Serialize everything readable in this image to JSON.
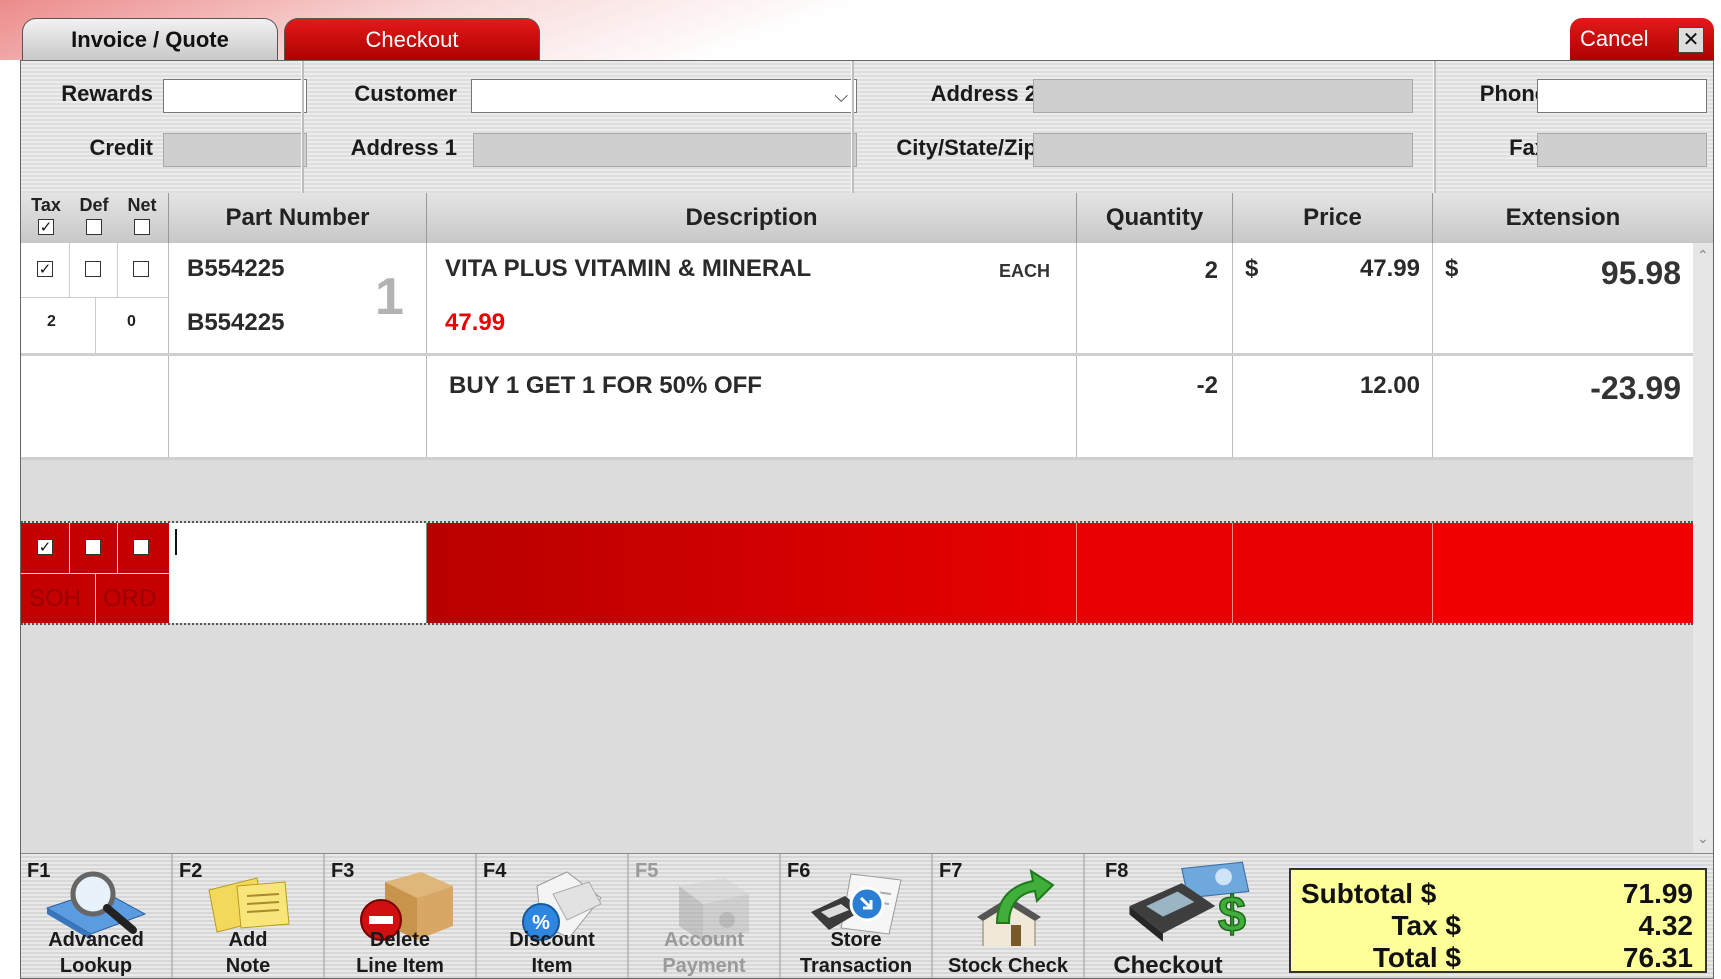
{
  "tabs": {
    "invoice_quote": "Invoice / Quote",
    "checkout": "Checkout",
    "cancel": "Cancel",
    "close_glyph": "✕"
  },
  "customer_form": {
    "rewards_label": "Rewards",
    "rewards_value": "",
    "credit_label": "Credit",
    "credit_value": "",
    "customer_label": "Customer",
    "customer_value": "",
    "address1_label": "Address 1",
    "address1_value": "",
    "address2_label": "Address 2",
    "address2_value": "",
    "city_state_zip_label": "City/State/Zip",
    "city_state_zip_value": "",
    "phone_label": "Phone",
    "phone_value": "",
    "fax_label": "Fax",
    "fax_value": ""
  },
  "grid": {
    "headers": {
      "tax": "Tax",
      "def": "Def",
      "net": "Net",
      "part_number": "Part Number",
      "description": "Description",
      "quantity": "Quantity",
      "price": "Price",
      "extension": "Extension"
    },
    "header_checks": {
      "tax": true,
      "def": false,
      "net": false
    },
    "line1": {
      "tax": true,
      "def": false,
      "net": false,
      "soh": "2",
      "ord": "0",
      "part_number": "B554225",
      "part_number_2": "B554225",
      "line_no": "1",
      "description": "VITA PLUS VITAMIN & MINERAL",
      "unit": "EACH",
      "regular_price": "47.99",
      "quantity": "2",
      "price_symbol": "$",
      "price": "47.99",
      "extension_symbol": "$",
      "extension": "95.98"
    },
    "line2": {
      "description": "BUY 1 GET 1 FOR 50% OFF",
      "quantity": "-2",
      "price": "12.00",
      "extension": "-23.99"
    },
    "entry_row": {
      "tax": true,
      "def": false,
      "net": false,
      "soh_label": "SOH",
      "ord_label": "ORD",
      "part_number": ""
    },
    "colors": {
      "entry_red": "#e00000",
      "regular_price_red": "#ee0000"
    }
  },
  "function_keys": [
    {
      "key": "F1",
      "line1": "Advanced",
      "line2": "Lookup",
      "icon": "magnifier-folder-icon",
      "enabled": true
    },
    {
      "key": "F2",
      "line1": "Add",
      "line2": "Note",
      "icon": "sticky-notes-icon",
      "enabled": true
    },
    {
      "key": "F3",
      "line1": "Delete",
      "line2": "Line Item",
      "icon": "box-delete-icon",
      "enabled": true
    },
    {
      "key": "F4",
      "line1": "Discount",
      "line2": "Item",
      "icon": "percent-tag-icon",
      "enabled": true
    },
    {
      "key": "F5",
      "line1": "Account",
      "line2": "Payment",
      "icon": "safe-icon",
      "enabled": false
    },
    {
      "key": "F6",
      "line1": "Store",
      "line2": "Transaction",
      "icon": "disk-document-icon",
      "enabled": true
    },
    {
      "key": "F7",
      "line1": "",
      "line2": "Stock Check",
      "icon": "house-arrow-icon",
      "enabled": true
    },
    {
      "key": "F8",
      "line1": "",
      "line2": "Checkout",
      "icon": "card-terminal-icon",
      "enabled": true
    }
  ],
  "totals": {
    "subtotal_label": "Subtotal $",
    "subtotal": "71.99",
    "tax_label": "Tax $",
    "tax": "4.32",
    "total_label": "Total $",
    "total": "76.31"
  }
}
